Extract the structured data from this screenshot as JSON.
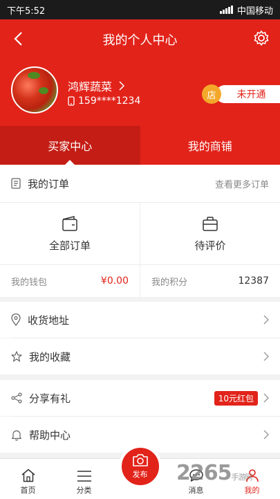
{
  "status_bar": {
    "time": "下午5:52",
    "carrier": "中国移动"
  },
  "header": {
    "title": "我的个人中心"
  },
  "profile": {
    "name": "鸿辉蔬菜",
    "phone": "159****1234",
    "shop_icon": "店",
    "shop_status": "未开通"
  },
  "tabs": [
    {
      "label": "买家中心",
      "active": true
    },
    {
      "label": "我的商铺",
      "active": false
    }
  ],
  "orders": {
    "title": "我的订单",
    "more": "查看更多订单",
    "items": [
      {
        "label": "全部订单",
        "icon": "wallet-icon"
      },
      {
        "label": "待评价",
        "icon": "bag-icon"
      }
    ]
  },
  "wallet": {
    "label": "我的钱包",
    "amount": "¥0.00"
  },
  "points": {
    "label": "我的积分",
    "value": "12387"
  },
  "menu": [
    {
      "label": "收货地址",
      "icon": "location-icon"
    },
    {
      "label": "我的收藏",
      "icon": "star-icon"
    },
    {
      "label": "分享有礼",
      "icon": "share-icon",
      "badge": "10元红包"
    },
    {
      "label": "帮助中心",
      "icon": "bell-icon"
    }
  ],
  "bottom_nav": [
    {
      "label": "首页",
      "icon": "home-icon"
    },
    {
      "label": "分类",
      "icon": "list-icon"
    },
    {
      "label": "发布",
      "icon": "camera-icon"
    },
    {
      "label": "消息",
      "icon": "message-icon"
    },
    {
      "label": "我的",
      "icon": "user-icon",
      "active": true
    }
  ],
  "watermark": {
    "main": "2265",
    "sub": "手游网"
  },
  "colors": {
    "primary": "#e2231a",
    "dark_red": "#c41d15",
    "shop_orange": "#f4a82a"
  }
}
